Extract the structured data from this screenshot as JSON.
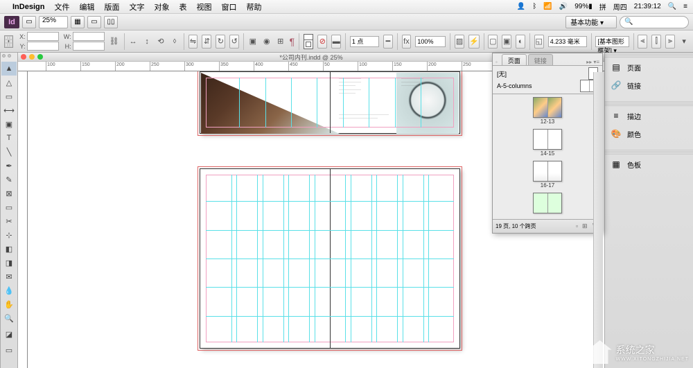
{
  "menubar": {
    "app": "InDesign",
    "items": [
      "文件",
      "编辑",
      "版面",
      "文字",
      "对象",
      "表",
      "视图",
      "窗口",
      "帮助"
    ],
    "battery": "99%",
    "ime": "拼",
    "day": "周四",
    "time": "21:39:12"
  },
  "toolbar1": {
    "logo": "Id",
    "zoom": "25%",
    "workspace": "基本功能",
    "search_placeholder": ""
  },
  "control": {
    "x_label": "X:",
    "y_label": "Y:",
    "w_label": "W:",
    "h_label": "H:",
    "stroke_weight": "1 点",
    "opacity": "100%",
    "measure": "4.233 毫米",
    "frame_type": "[基本图形框架]"
  },
  "document": {
    "title": "*公司内刊.indd @ 25%",
    "ruler_marks": [
      {
        "pos": 40,
        "label": "100"
      },
      {
        "pos": 90,
        "label": "150"
      },
      {
        "pos": 140,
        "label": "200"
      },
      {
        "pos": 190,
        "label": "250"
      },
      {
        "pos": 240,
        "label": "300"
      },
      {
        "pos": 290,
        "label": "350"
      },
      {
        "pos": 340,
        "label": "400"
      },
      {
        "pos": 390,
        "label": "450"
      },
      {
        "pos": 440,
        "label": "50"
      },
      {
        "pos": 490,
        "label": "100"
      },
      {
        "pos": 540,
        "label": "150"
      },
      {
        "pos": 590,
        "label": "200"
      },
      {
        "pos": 640,
        "label": "250"
      }
    ]
  },
  "pages_panel": {
    "tab_pages": "页面",
    "tab_links": "链接",
    "master_none": "[无]",
    "master_a": "A-5-columns",
    "spreads": [
      "12-13",
      "14-15",
      "16-17"
    ],
    "status": "19 页, 10 个跨页"
  },
  "dock": {
    "items": [
      {
        "icon": "pages-icon",
        "glyph": "▤",
        "label": "页面"
      },
      {
        "icon": "links-icon",
        "glyph": "🔗",
        "label": "链接"
      },
      {
        "icon": "stroke-icon",
        "glyph": "≡",
        "label": "描边"
      },
      {
        "icon": "color-icon",
        "glyph": "🎨",
        "label": "颜色"
      },
      {
        "icon": "swatches-icon",
        "glyph": "▦",
        "label": "色板"
      }
    ]
  },
  "watermark": {
    "title": "系统之家",
    "url": "WWW.XITONGZHIJIA.NET"
  }
}
